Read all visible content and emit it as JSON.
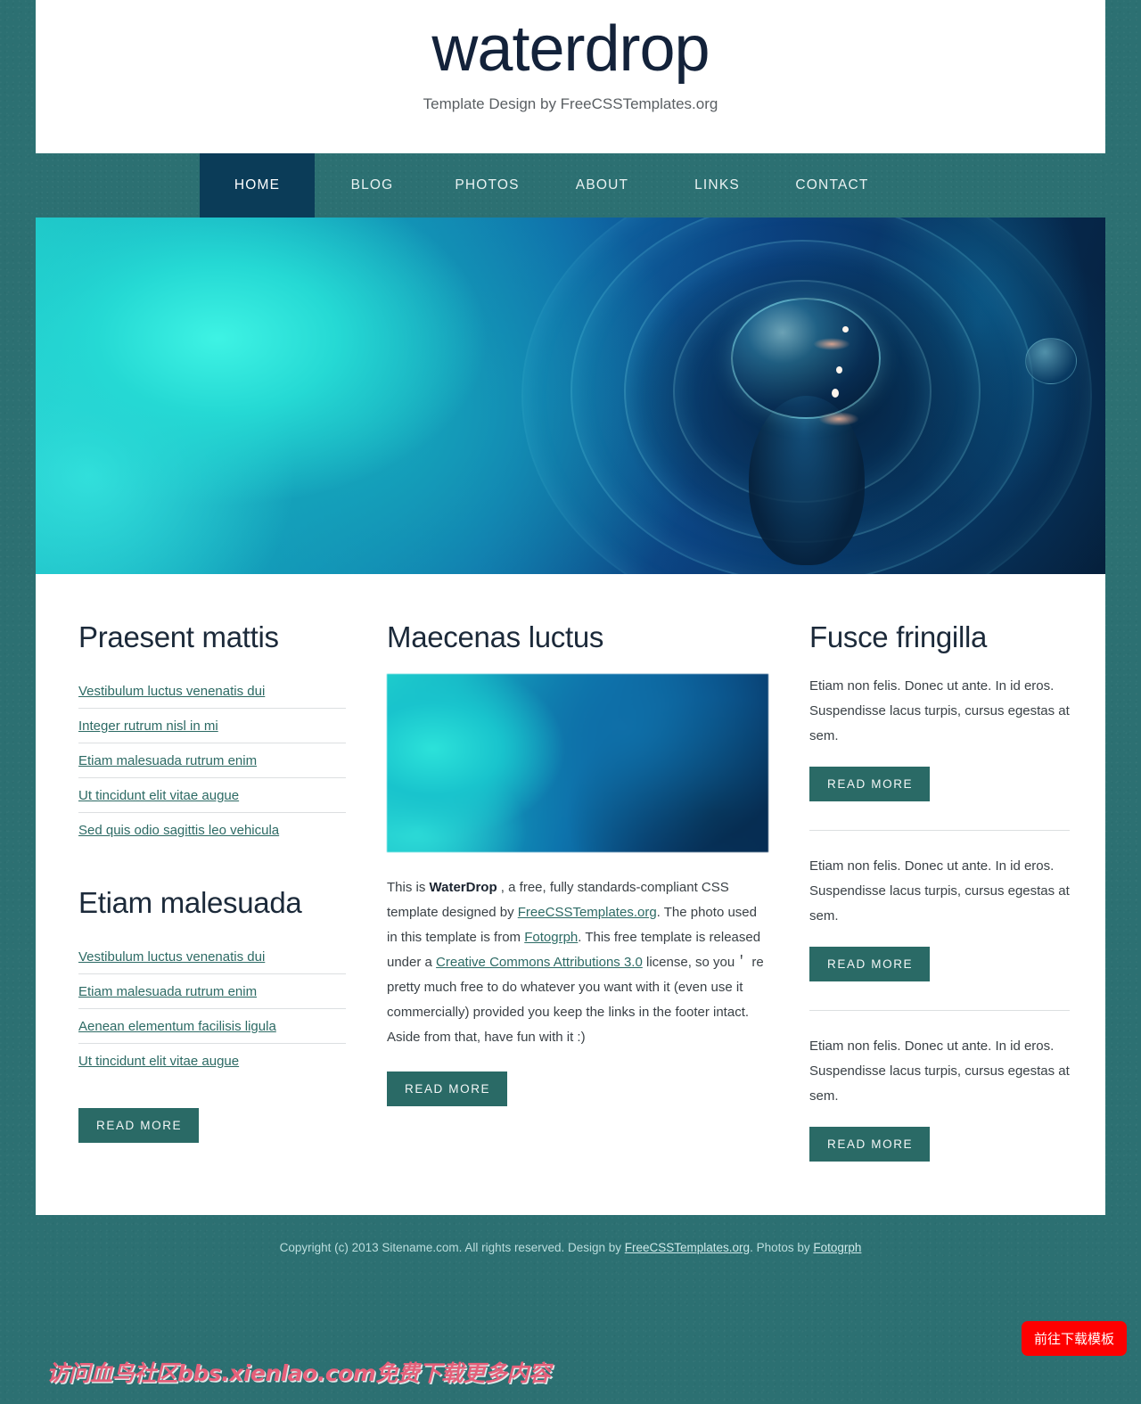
{
  "header": {
    "title": "waterdrop",
    "tagline": "Template Design by FreeCSSTemplates.org"
  },
  "nav": {
    "items": [
      {
        "label": "HOME",
        "active": true
      },
      {
        "label": "BLOG",
        "active": false
      },
      {
        "label": "PHOTOS",
        "active": false
      },
      {
        "label": "ABOUT",
        "active": false
      },
      {
        "label": "LINKS",
        "active": false
      },
      {
        "label": "CONTACT",
        "active": false
      }
    ]
  },
  "hero": {
    "alt": "water droplet splash photo"
  },
  "left_column": {
    "blocks": [
      {
        "title": "Praesent mattis",
        "links": [
          "Vestibulum luctus venenatis dui",
          "Integer rutrum nisl in mi",
          "Etiam malesuada rutrum enim",
          "Ut tincidunt elit vitae augue",
          "Sed quis odio sagittis leo vehicula"
        ]
      },
      {
        "title": "Etiam malesuada",
        "links": [
          "Vestibulum luctus venenatis dui",
          "Etiam malesuada rutrum enim",
          "Aenean elementum facilisis ligula",
          "Ut tincidunt elit vitae augue"
        ],
        "read_more": "READ MORE"
      }
    ]
  },
  "mid_column": {
    "title": "Maecenas luctus",
    "figure_alt": "blurred water texture thumbnail",
    "paragraph": {
      "p1": "This is ",
      "strong1": "WaterDrop",
      "p2": " , a free, fully standards-compliant CSS template designed by ",
      "link1": "FreeCSSTemplates.org",
      "p3": ". The photo used in this template is from ",
      "link2": "Fotogrph",
      "p4": ". This free template is released under a ",
      "link3": "Creative Commons Attributions 3.0",
      "p5": " license, so you＇ re pretty much free to do whatever you want with it (even use it commercially) provided you keep the links in the footer intact. Aside from that, have fun with it :)"
    },
    "read_more": "READ MORE"
  },
  "right_column": {
    "title": "Fusce fringilla",
    "blocks": [
      {
        "text": "Etiam non felis. Donec ut ante. In id eros. Suspendisse lacus turpis, cursus egestas at sem.",
        "read_more": "READ MORE"
      },
      {
        "text": "Etiam non felis. Donec ut ante. In id eros. Suspendisse lacus turpis, cursus egestas at sem.",
        "read_more": "READ MORE"
      },
      {
        "text": "Etiam non felis. Donec ut ante. In id eros. Suspendisse lacus turpis, cursus egestas at sem.",
        "read_more": "READ MORE"
      }
    ]
  },
  "footer": {
    "copyright": "Copyright (c) 2013 Sitename.com. All rights reserved. Design by ",
    "link1": "FreeCSSTemplates.org",
    "middle": ". Photos by ",
    "link2": "Fotogrph"
  },
  "overlays": {
    "download_button": "前往下载模板",
    "watermark": "访问血鸟社区bbs.xienlao.com免费下载更多内容"
  },
  "colors": {
    "page_background": "#2c7072",
    "nav_active": "#0b3c58",
    "button": "#2a6a66",
    "heading": "#1c2a3a",
    "link": "#2c6a64",
    "download_button": "#fe0000",
    "watermark": "#e4607a"
  }
}
